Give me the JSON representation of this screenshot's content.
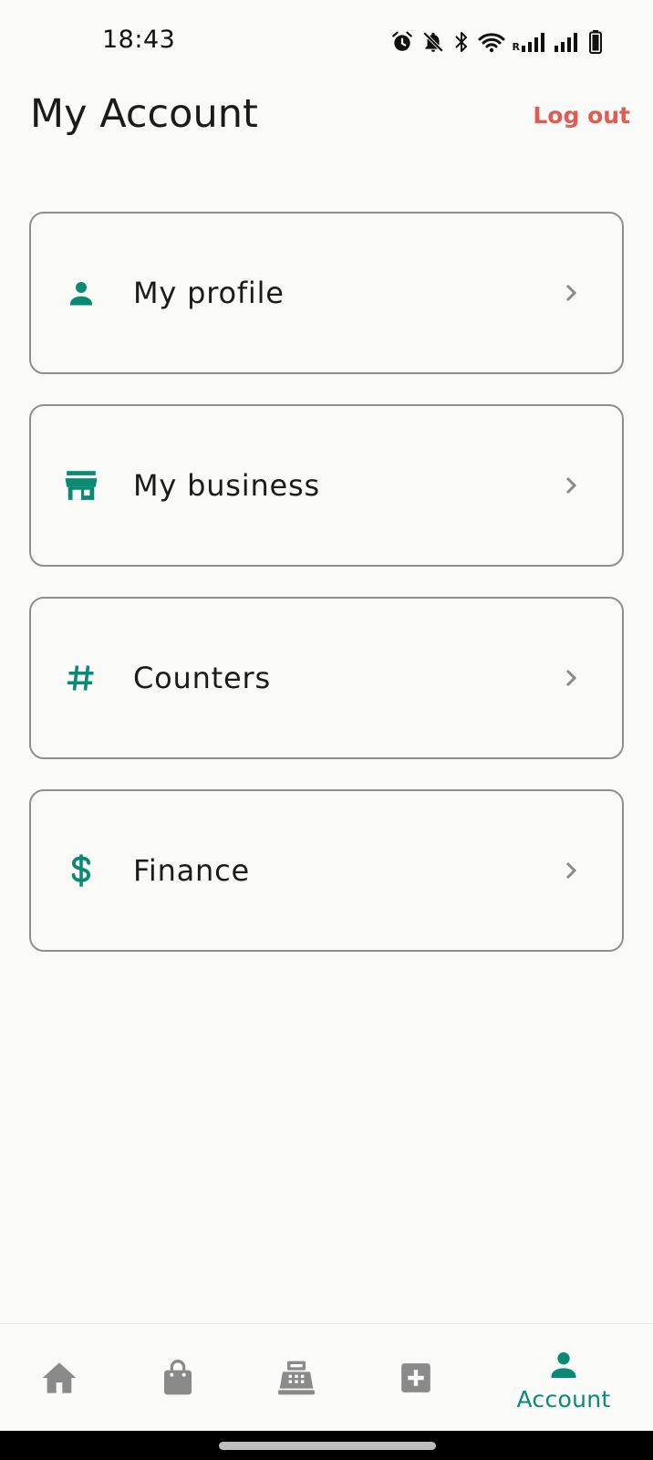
{
  "status_bar": {
    "time": "18:43",
    "icons": [
      "alarm-icon",
      "bell-off-icon",
      "bluetooth-icon",
      "wifi-icon",
      "signal-roaming-icon",
      "signal-icon",
      "battery-icon"
    ],
    "roaming_indicator": "R"
  },
  "header": {
    "title": "My Account",
    "logout_label": "Log out"
  },
  "menu": [
    {
      "label": "My profile",
      "icon": "person-icon"
    },
    {
      "label": "My business",
      "icon": "store-icon"
    },
    {
      "label": "Counters",
      "icon": "hash-icon"
    },
    {
      "label": "Finance",
      "icon": "dollar-icon"
    }
  ],
  "bottom_nav": [
    {
      "icon": "home-icon",
      "label": ""
    },
    {
      "icon": "shopping-bag-icon",
      "label": ""
    },
    {
      "icon": "cash-register-icon",
      "label": ""
    },
    {
      "icon": "add-box-icon",
      "label": ""
    },
    {
      "icon": "person-icon",
      "label": "Account",
      "active": true
    }
  ],
  "colors": {
    "accent": "#0a8a73",
    "logout": "#e25b52",
    "inactive_icon": "#8a8a8a",
    "card_border": "#8e8e8e",
    "background": "#fafbf9"
  }
}
